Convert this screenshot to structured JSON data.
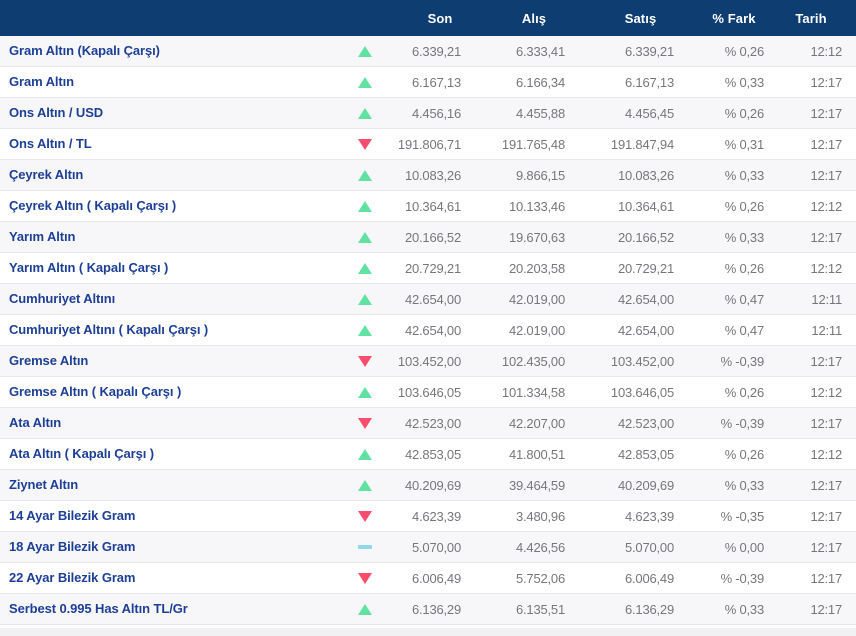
{
  "colors": {
    "header_bg": "#0e3d72",
    "link": "#1e3f96",
    "value": "#76777b",
    "up": "#61e2a2",
    "down": "#f94d6d",
    "flat": "#90d7e7",
    "odd_row_bg": "#f7f7f9",
    "border": "#e9e9eb",
    "bottom_strip": "#f1f1f3"
  },
  "table": {
    "columns": [
      "Son",
      "Alış",
      "Satış",
      "% Fark",
      "Tarih"
    ],
    "rows": [
      {
        "name": "Gram Altın (Kapalı Çarşı)",
        "direction": "up",
        "son": "6.339,21",
        "alis": "6.333,41",
        "satis": "6.339,21",
        "fark": "% 0,26",
        "tarih": "12:12"
      },
      {
        "name": "Gram Altın",
        "direction": "up",
        "son": "6.167,13",
        "alis": "6.166,34",
        "satis": "6.167,13",
        "fark": "% 0,33",
        "tarih": "12:17"
      },
      {
        "name": "Ons Altın / USD",
        "direction": "up",
        "son": "4.456,16",
        "alis": "4.455,88",
        "satis": "4.456,45",
        "fark": "% 0,26",
        "tarih": "12:17"
      },
      {
        "name": "Ons Altın / TL",
        "direction": "down",
        "son": "191.806,71",
        "alis": "191.765,48",
        "satis": "191.847,94",
        "fark": "% 0,31",
        "tarih": "12:17"
      },
      {
        "name": "Çeyrek Altın",
        "direction": "up",
        "son": "10.083,26",
        "alis": "9.866,15",
        "satis": "10.083,26",
        "fark": "% 0,33",
        "tarih": "12:17"
      },
      {
        "name": "Çeyrek Altın ( Kapalı Çarşı )",
        "direction": "up",
        "son": "10.364,61",
        "alis": "10.133,46",
        "satis": "10.364,61",
        "fark": "% 0,26",
        "tarih": "12:12"
      },
      {
        "name": "Yarım Altın",
        "direction": "up",
        "son": "20.166,52",
        "alis": "19.670,63",
        "satis": "20.166,52",
        "fark": "% 0,33",
        "tarih": "12:17"
      },
      {
        "name": "Yarım Altın ( Kapalı Çarşı )",
        "direction": "up",
        "son": "20.729,21",
        "alis": "20.203,58",
        "satis": "20.729,21",
        "fark": "% 0,26",
        "tarih": "12:12"
      },
      {
        "name": "Cumhuriyet Altını",
        "direction": "up",
        "son": "42.654,00",
        "alis": "42.019,00",
        "satis": "42.654,00",
        "fark": "% 0,47",
        "tarih": "12:11"
      },
      {
        "name": "Cumhuriyet Altını ( Kapalı Çarşı )",
        "direction": "up",
        "son": "42.654,00",
        "alis": "42.019,00",
        "satis": "42.654,00",
        "fark": "% 0,47",
        "tarih": "12:11"
      },
      {
        "name": "Gremse Altın",
        "direction": "down",
        "son": "103.452,00",
        "alis": "102.435,00",
        "satis": "103.452,00",
        "fark": "% -0,39",
        "tarih": "12:17"
      },
      {
        "name": "Gremse Altın ( Kapalı Çarşı )",
        "direction": "up",
        "son": "103.646,05",
        "alis": "101.334,58",
        "satis": "103.646,05",
        "fark": "% 0,26",
        "tarih": "12:12"
      },
      {
        "name": "Ata Altın",
        "direction": "down",
        "son": "42.523,00",
        "alis": "42.207,00",
        "satis": "42.523,00",
        "fark": "% -0,39",
        "tarih": "12:17"
      },
      {
        "name": "Ata Altın ( Kapalı Çarşı )",
        "direction": "up",
        "son": "42.853,05",
        "alis": "41.800,51",
        "satis": "42.853,05",
        "fark": "% 0,26",
        "tarih": "12:12"
      },
      {
        "name": "Ziynet Altın",
        "direction": "up",
        "son": "40.209,69",
        "alis": "39.464,59",
        "satis": "40.209,69",
        "fark": "% 0,33",
        "tarih": "12:17"
      },
      {
        "name": "14 Ayar Bilezik Gram",
        "direction": "down",
        "son": "4.623,39",
        "alis": "3.480,96",
        "satis": "4.623,39",
        "fark": "% -0,35",
        "tarih": "12:17"
      },
      {
        "name": "18 Ayar Bilezik Gram",
        "direction": "flat",
        "son": "5.070,00",
        "alis": "4.426,56",
        "satis": "5.070,00",
        "fark": "% 0,00",
        "tarih": "12:17"
      },
      {
        "name": "22 Ayar Bilezik Gram",
        "direction": "down",
        "son": "6.006,49",
        "alis": "5.752,06",
        "satis": "6.006,49",
        "fark": "% -0,39",
        "tarih": "12:17"
      },
      {
        "name": "Serbest 0.995 Has Altın TL/Gr",
        "direction": "up",
        "son": "6.136,29",
        "alis": "6.135,51",
        "satis": "6.136,29",
        "fark": "% 0,33",
        "tarih": "12:17"
      }
    ]
  }
}
